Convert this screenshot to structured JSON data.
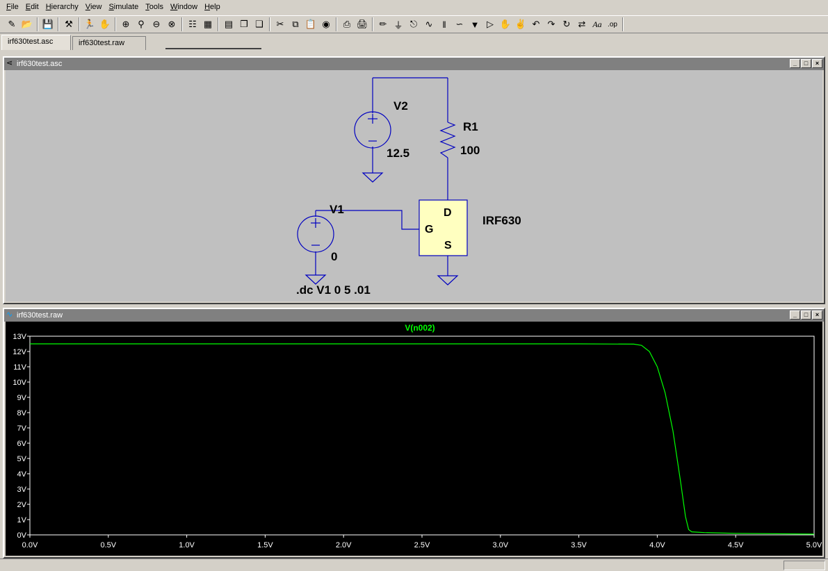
{
  "menu": [
    {
      "key": "F",
      "rest": "ile"
    },
    {
      "key": "E",
      "rest": "dit"
    },
    {
      "key": "H",
      "rest": "ierarchy"
    },
    {
      "key": "V",
      "rest": "iew"
    },
    {
      "key": "S",
      "rest": "imulate"
    },
    {
      "key": "T",
      "rest": "ools"
    },
    {
      "key": "W",
      "rest": "indow"
    },
    {
      "key": "H",
      "rest": "elp"
    }
  ],
  "tabs": [
    {
      "label": "irf630test.asc"
    },
    {
      "label": "irf630test.raw"
    }
  ],
  "schematic_window": {
    "title": "irf630test.asc",
    "components": {
      "v2": {
        "name": "V2",
        "value": "12.5"
      },
      "r1": {
        "name": "R1",
        "value": "100"
      },
      "v1": {
        "name": "V1",
        "value": "0"
      },
      "m1": {
        "name": "IRF630",
        "pin_d": "D",
        "pin_g": "G",
        "pin_s": "S"
      }
    },
    "directive": ".dc V1 0 5 .01"
  },
  "plot_window": {
    "title": "irf630test.raw",
    "trace_color": "#00ff00"
  },
  "chart_data": {
    "type": "line",
    "title": "V(n002)",
    "xlabel": "",
    "ylabel": "",
    "xlim": [
      0,
      5
    ],
    "ylim": [
      0,
      13
    ],
    "x_ticks": [
      "0.0V",
      "0.5V",
      "1.0V",
      "1.5V",
      "2.0V",
      "2.5V",
      "3.0V",
      "3.5V",
      "4.0V",
      "4.5V",
      "5.0V"
    ],
    "y_ticks": [
      "0V",
      "1V",
      "2V",
      "3V",
      "4V",
      "5V",
      "6V",
      "7V",
      "8V",
      "9V",
      "10V",
      "11V",
      "12V",
      "13V"
    ],
    "series": [
      {
        "name": "V(n002)",
        "color": "#00ff00",
        "x": [
          0.0,
          1.0,
          2.0,
          3.0,
          3.5,
          3.85,
          3.9,
          3.95,
          4.0,
          4.05,
          4.1,
          4.15,
          4.18,
          4.2,
          4.22,
          4.3,
          4.5,
          5.0
        ],
        "y": [
          12.5,
          12.5,
          12.5,
          12.5,
          12.5,
          12.48,
          12.4,
          12.0,
          11.0,
          9.3,
          6.8,
          3.4,
          1.2,
          0.35,
          0.2,
          0.15,
          0.1,
          0.05
        ]
      }
    ]
  }
}
